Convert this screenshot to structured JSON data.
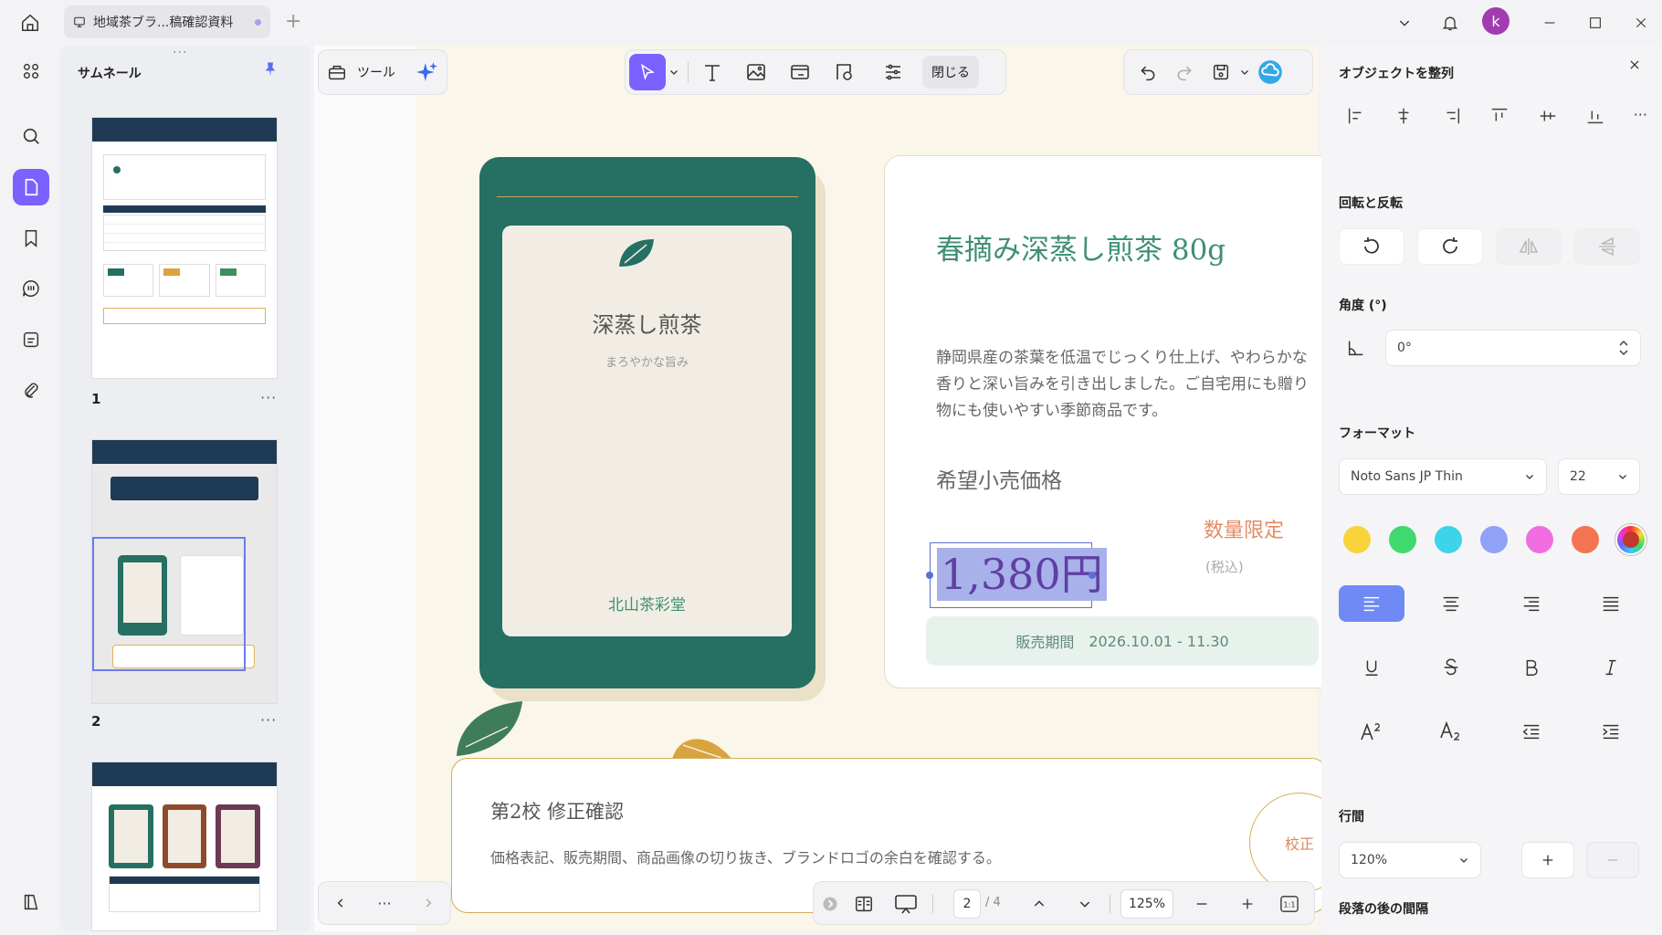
{
  "tab": {
    "title": "地域茶ブラ...稿確認資料"
  },
  "user": {
    "initial": "k"
  },
  "thumbnails": {
    "title": "サムネール",
    "pages": [
      {
        "num": "1",
        "more": "···"
      },
      {
        "num": "2",
        "more": "···"
      }
    ]
  },
  "toolbar": {
    "tools_label": "ツール",
    "close_label": "閉じる"
  },
  "product": {
    "package_title": "深蒸し煎茶",
    "package_sub": "まろやかな旨み",
    "package_brand": "北山茶彩堂",
    "name": "春摘み深蒸し煎茶 80g",
    "description": "静岡県産の茶葉を低温でじっくり仕上げ、やわらかな香りと深い旨みを引き出しました。ご自宅用にも贈り物にも使いやすい季節商品です。",
    "price_label": "希望小売価格",
    "price": "1,380円",
    "limited": "数量限定",
    "tax": "(税込)",
    "period_label": "販売期間",
    "period_value": "2026.10.01 - 11.30"
  },
  "note": {
    "title": "第2校 修正確認",
    "body": "価格表記、販売期間、商品画像の切り抜き、ブランドロゴの余白を確認する。",
    "stamp": "校正"
  },
  "pagebar": {
    "current_page": "2",
    "total_pages": "/ 4",
    "zoom": "125%",
    "nav_more": "···"
  },
  "right_panel": {
    "align_title": "オブジェクトを整列",
    "rotate_title": "回転と反転",
    "angle_title": "角度 (°)",
    "angle_value": "0°",
    "format_title": "フォーマット",
    "font_name": "Noto Sans JP Thin",
    "font_size": "22",
    "line_title": "行間",
    "line_value": "120%",
    "para_title": "段落の後の間隔",
    "colors": [
      "#f7d43a",
      "#3fd96d",
      "#3dd3e8",
      "#8fa2f5",
      "#f06ee0",
      "#f27452"
    ]
  }
}
